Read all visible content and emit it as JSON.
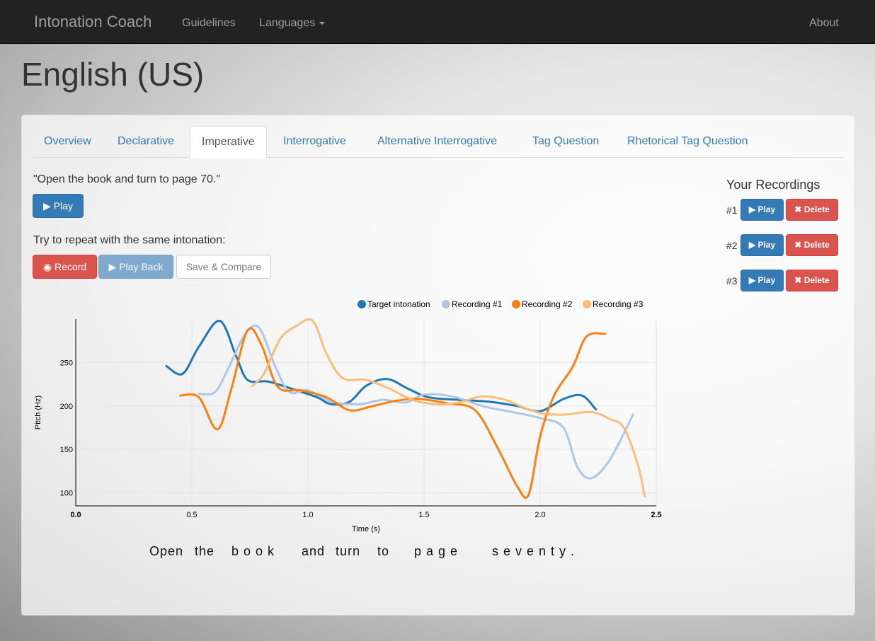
{
  "navbar": {
    "brand": "Intonation Coach",
    "guidelines": "Guidelines",
    "languages": "Languages",
    "about": "About"
  },
  "page": {
    "title": "English (US)"
  },
  "tabs": [
    {
      "label": "Overview"
    },
    {
      "label": "Declarative"
    },
    {
      "label": "Imperative",
      "active": true
    },
    {
      "label": "Interrogative"
    },
    {
      "label": "Alternative Interrogative"
    },
    {
      "label": "Tag Question"
    },
    {
      "label": "Rhetorical Tag Question"
    }
  ],
  "exercise": {
    "sentence": "\"Open the book and turn to page 70.\"",
    "play_label": "Play",
    "prompt": "Try to repeat with the same intonation:",
    "record_label": "Record",
    "playback_label": "Play Back",
    "save_label": "Save & Compare"
  },
  "recordings": {
    "title": "Your Recordings",
    "items": [
      {
        "num": "#1",
        "play": "Play",
        "delete": "Delete"
      },
      {
        "num": "#2",
        "play": "Play",
        "delete": "Delete"
      },
      {
        "num": "#3",
        "play": "Play",
        "delete": "Delete"
      }
    ]
  },
  "lyrics": [
    "Open",
    "the",
    "b o o k",
    "and",
    "turn",
    "to",
    "p a g e",
    "s e v e n t y ."
  ],
  "chart_data": {
    "type": "line",
    "xlabel": "Time (s)",
    "ylabel": "Pitch (Hz)",
    "xlim": [
      0.0,
      2.5
    ],
    "ylim": [
      85,
      300
    ],
    "x_ticks": [
      "0.0",
      "0.5",
      "1.0",
      "1.5",
      "2.0",
      "2.5"
    ],
    "x_tick_values": [
      0,
      0.5,
      1.0,
      1.5,
      2.0,
      2.5
    ],
    "y_ticks": [
      "100",
      "150",
      "200",
      "250"
    ],
    "y_tick_values": [
      100,
      150,
      200,
      250
    ],
    "grid": true,
    "legend": "top",
    "series": [
      {
        "name": "Target intonation",
        "color": "#1f77b4",
        "points": [
          [
            0.39,
            246
          ],
          [
            0.46,
            237
          ],
          [
            0.53,
            268
          ],
          [
            0.62,
            298
          ],
          [
            0.69,
            258
          ],
          [
            0.74,
            230
          ],
          [
            0.83,
            228
          ],
          [
            0.95,
            218
          ],
          [
            1.04,
            210
          ],
          [
            1.1,
            202
          ],
          [
            1.18,
            205
          ],
          [
            1.25,
            223
          ],
          [
            1.34,
            231
          ],
          [
            1.43,
            220
          ],
          [
            1.52,
            210
          ],
          [
            1.65,
            207
          ],
          [
            1.78,
            205
          ],
          [
            1.9,
            200
          ],
          [
            2.0,
            194
          ],
          [
            2.1,
            208
          ],
          [
            2.18,
            212
          ],
          [
            2.24,
            196
          ]
        ]
      },
      {
        "name": "Recording #1",
        "color": "#aec7e8",
        "points": [
          [
            0.53,
            214
          ],
          [
            0.6,
            216
          ],
          [
            0.66,
            245
          ],
          [
            0.73,
            283
          ],
          [
            0.79,
            290
          ],
          [
            0.86,
            245
          ],
          [
            0.92,
            216
          ],
          [
            1.0,
            218
          ],
          [
            1.1,
            205
          ],
          [
            1.22,
            202
          ],
          [
            1.32,
            207
          ],
          [
            1.42,
            204
          ],
          [
            1.5,
            213
          ],
          [
            1.62,
            211
          ],
          [
            1.75,
            200
          ],
          [
            1.88,
            193
          ],
          [
            2.0,
            186
          ],
          [
            2.1,
            175
          ],
          [
            2.16,
            130
          ],
          [
            2.22,
            117
          ],
          [
            2.3,
            138
          ],
          [
            2.4,
            190
          ]
        ]
      },
      {
        "name": "Recording #2",
        "color": "#ff7f0e",
        "points": [
          [
            0.45,
            212
          ],
          [
            0.53,
            210
          ],
          [
            0.61,
            173
          ],
          [
            0.67,
            220
          ],
          [
            0.74,
            287
          ],
          [
            0.8,
            270
          ],
          [
            0.87,
            222
          ],
          [
            0.97,
            218
          ],
          [
            1.08,
            210
          ],
          [
            1.18,
            195
          ],
          [
            1.28,
            200
          ],
          [
            1.38,
            206
          ],
          [
            1.48,
            208
          ],
          [
            1.6,
            203
          ],
          [
            1.72,
            195
          ],
          [
            1.82,
            150
          ],
          [
            1.9,
            108
          ],
          [
            1.95,
            98
          ],
          [
            2.0,
            165
          ],
          [
            2.06,
            212
          ],
          [
            2.14,
            245
          ],
          [
            2.2,
            280
          ],
          [
            2.28,
            283
          ]
        ]
      },
      {
        "name": "Recording #3",
        "color": "#ffbb78",
        "points": [
          [
            0.76,
            223
          ],
          [
            0.81,
            237
          ],
          [
            0.88,
            277
          ],
          [
            0.95,
            292
          ],
          [
            1.02,
            298
          ],
          [
            1.08,
            260
          ],
          [
            1.15,
            232
          ],
          [
            1.25,
            230
          ],
          [
            1.35,
            220
          ],
          [
            1.45,
            207
          ],
          [
            1.55,
            202
          ],
          [
            1.65,
            204
          ],
          [
            1.75,
            211
          ],
          [
            1.85,
            207
          ],
          [
            1.93,
            198
          ],
          [
            2.0,
            192
          ],
          [
            2.1,
            190
          ],
          [
            2.22,
            193
          ],
          [
            2.3,
            185
          ],
          [
            2.36,
            175
          ],
          [
            2.42,
            133
          ],
          [
            2.45,
            96
          ]
        ]
      }
    ]
  }
}
